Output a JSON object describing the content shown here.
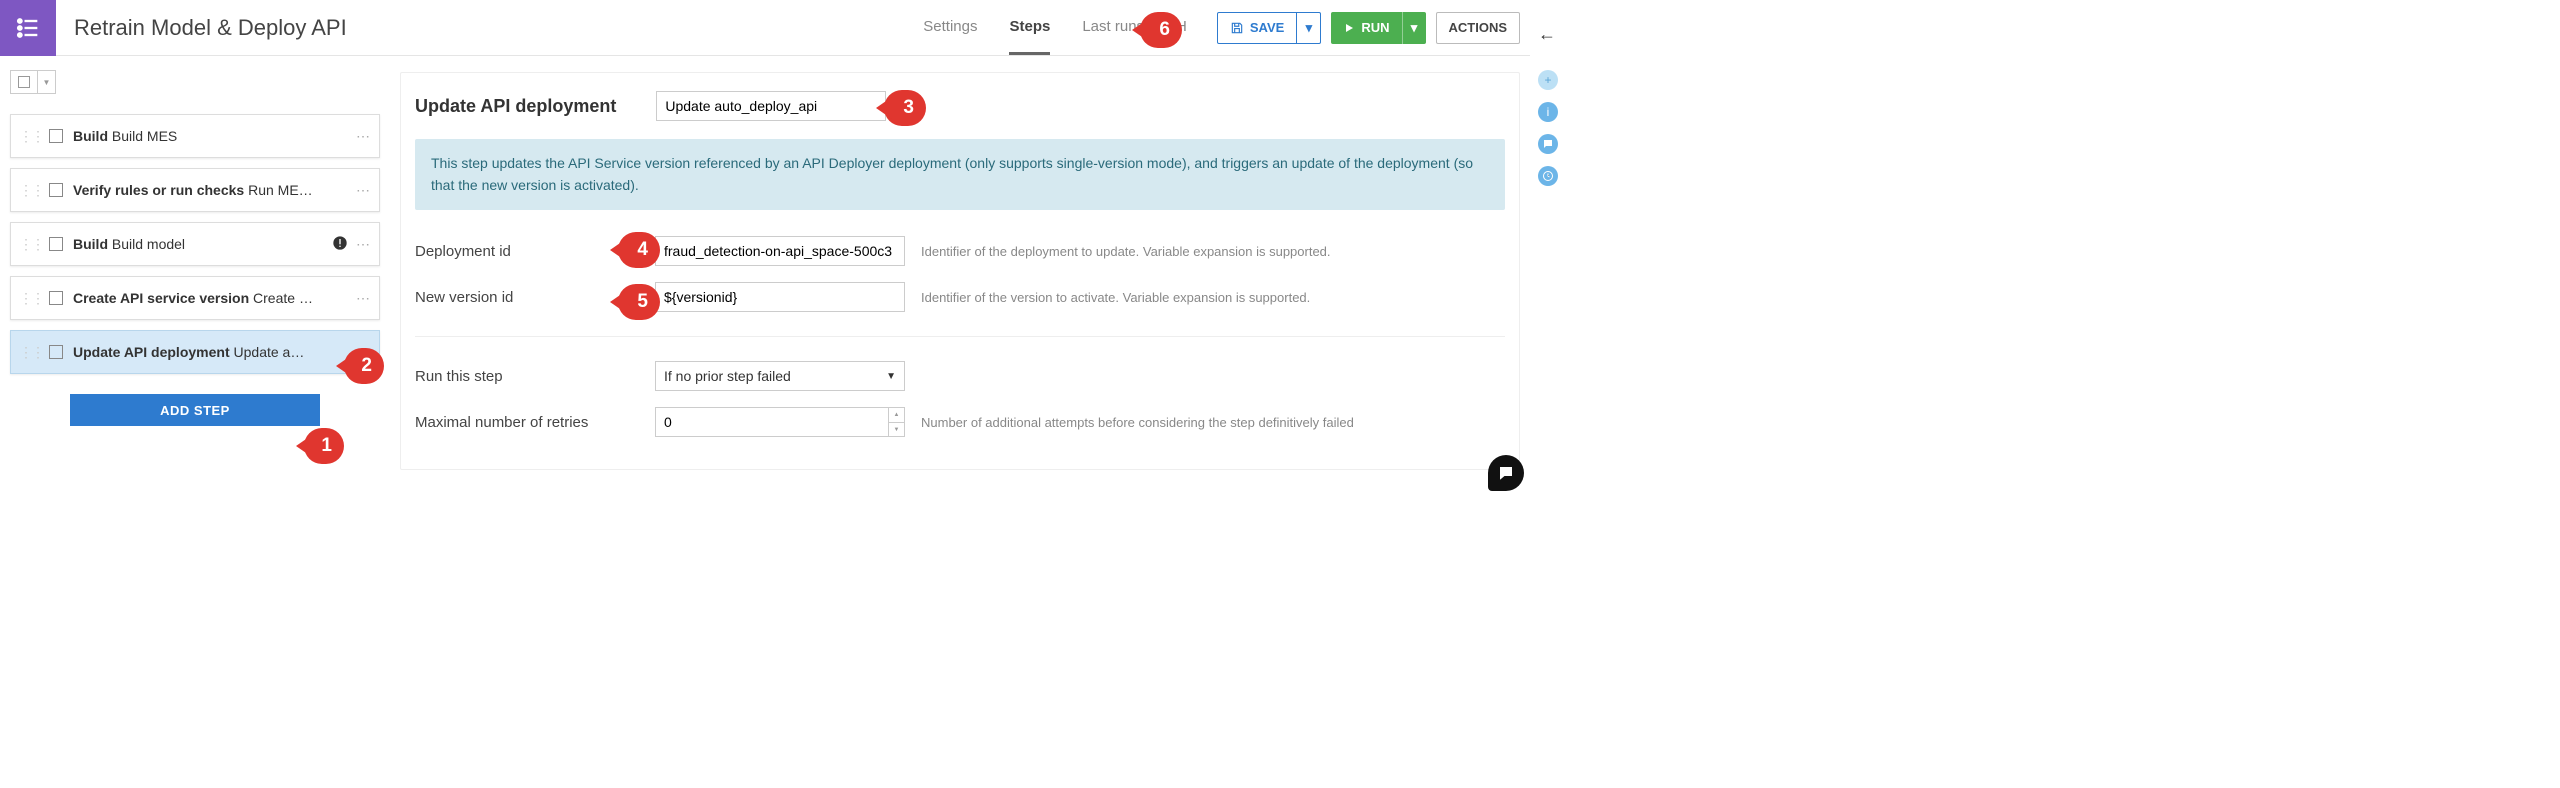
{
  "header": {
    "title": "Retrain Model & Deploy API",
    "tabs": {
      "settings": "Settings",
      "steps": "Steps",
      "last_runs": "Last runs",
      "h": "H"
    },
    "save": "SAVE",
    "run": "RUN",
    "actions": "ACTIONS"
  },
  "steps": [
    {
      "type": "Build",
      "rest": "Build MES"
    },
    {
      "type": "Verify rules or run checks",
      "rest": "Run ME…"
    },
    {
      "type": "Build",
      "rest": "Build model"
    },
    {
      "type": "Create API service version",
      "rest": "Create …"
    },
    {
      "type": "Update API deployment",
      "rest": "Update a…"
    }
  ],
  "add_step": "ADD STEP",
  "detail": {
    "title": "Update API deployment",
    "name_value": "Update auto_deploy_api",
    "banner": "This step updates the API Service version referenced by an API Deployer deployment (only supports single-version mode), and triggers an update of the deployment (so that the new version is activated).",
    "fields": {
      "deployment_id": {
        "label": "Deployment id",
        "value": "fraud_detection-on-api_space-500c3",
        "help": "Identifier of the deployment to update. Variable expansion is supported."
      },
      "new_version_id": {
        "label": "New version id",
        "value": "${versionid}",
        "help": "Identifier of the version to activate. Variable expansion is supported."
      },
      "run_this_step": {
        "label": "Run this step",
        "value": "If no prior step failed"
      },
      "max_retries": {
        "label": "Maximal number of retries",
        "value": "0",
        "help": "Number of additional attempts before considering the step definitively failed"
      }
    }
  },
  "annotations": {
    "1": "1",
    "2": "2",
    "3": "3",
    "4": "4",
    "5": "5",
    "6": "6"
  }
}
